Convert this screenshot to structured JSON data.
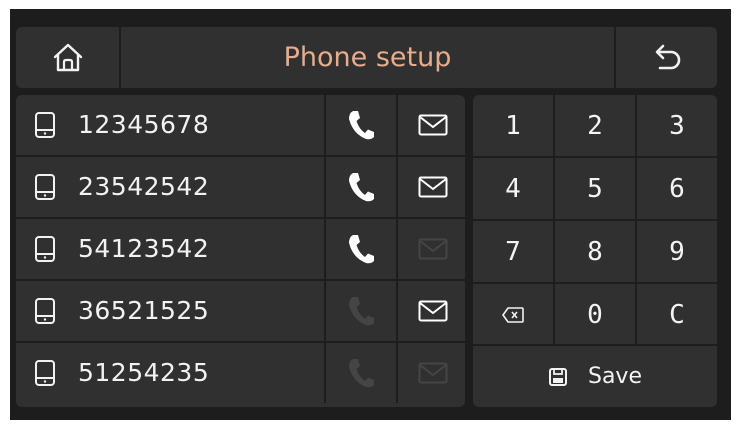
{
  "header": {
    "title": "Phone setup",
    "home_icon": "home-icon",
    "back_icon": "undo-arrow-icon"
  },
  "colors": {
    "title": "#e6ac8d",
    "panel": "#303030",
    "background": "#1d1d1d",
    "enabled_icon": "#ffffff",
    "disabled_icon": "#454545"
  },
  "contacts": [
    {
      "number": "12345678",
      "call_enabled": true,
      "message_enabled": true
    },
    {
      "number": "23542542",
      "call_enabled": true,
      "message_enabled": true
    },
    {
      "number": "54123542",
      "call_enabled": true,
      "message_enabled": false
    },
    {
      "number": "36521525",
      "call_enabled": false,
      "message_enabled": true
    },
    {
      "number": "51254235",
      "call_enabled": false,
      "message_enabled": false
    }
  ],
  "keypad": {
    "keys": [
      "1",
      "2",
      "3",
      "4",
      "5",
      "6",
      "7",
      "8",
      "9",
      "⌫",
      "0",
      "C"
    ],
    "save_label": "Save",
    "save_icon": "floppy-disk-icon",
    "backspace_icon": "backspace-icon"
  }
}
